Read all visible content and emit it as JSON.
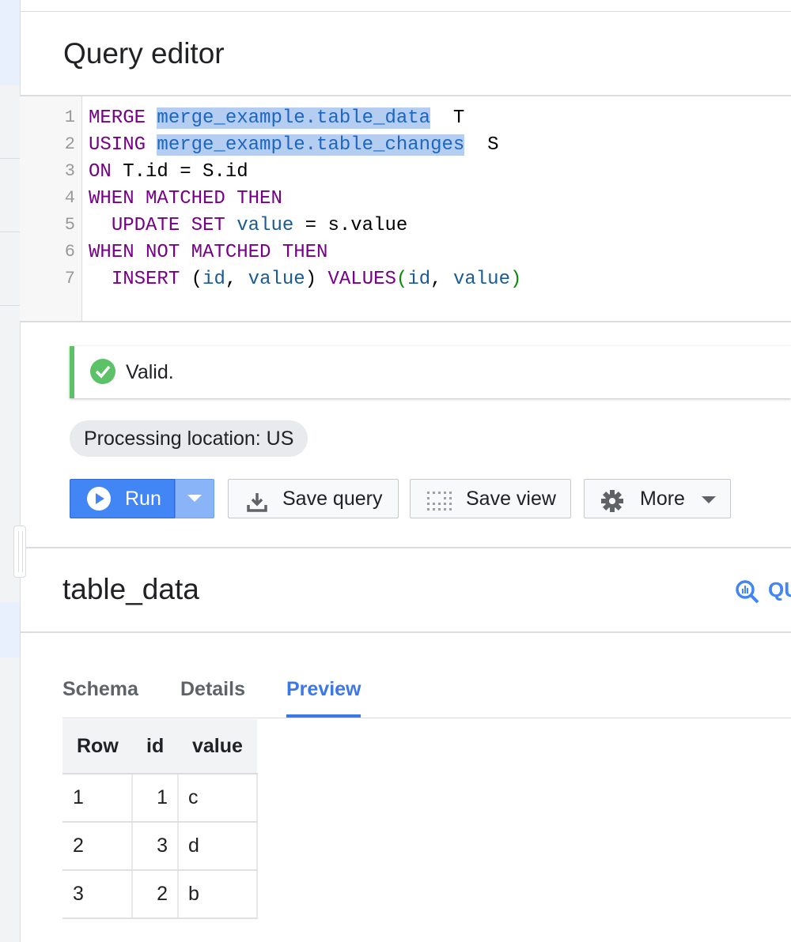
{
  "editor": {
    "title": "Query editor",
    "line_numbers": [
      "1",
      "2",
      "3",
      "4",
      "5",
      "6",
      "7"
    ]
  },
  "validation": {
    "message": "Valid."
  },
  "processing_location": "Processing location: US",
  "toolbar": {
    "run_label": "Run",
    "save_query_label": "Save query",
    "save_view_label": "Save view",
    "more_label": "More"
  },
  "table": {
    "title": "table_data",
    "query_link_label": "QU",
    "tabs": [
      "Schema",
      "Details",
      "Preview"
    ],
    "active_tab": "Preview",
    "columns": [
      "Row",
      "id",
      "value"
    ],
    "rows": [
      [
        "1",
        "1",
        "c"
      ],
      [
        "2",
        "3",
        "d"
      ],
      [
        "3",
        "2",
        "b"
      ]
    ]
  },
  "colors": {
    "accent": "#4285f4",
    "valid_green": "#5cc267",
    "keyword": "#770088",
    "identifier": "#1a5a96"
  }
}
